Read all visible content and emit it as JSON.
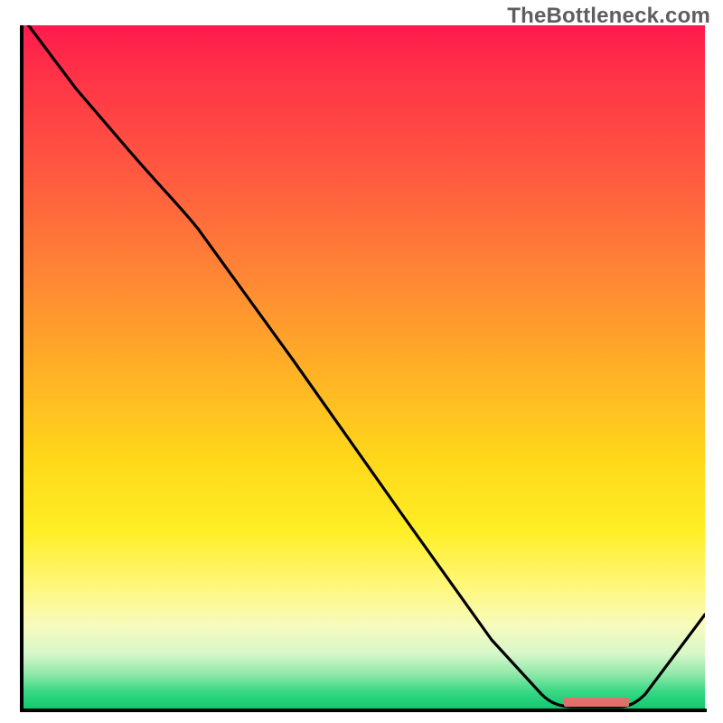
{
  "watermark": "TheBottleneck.com",
  "colors": {
    "axis": "#000000",
    "curve": "#000000",
    "marker": "#e0716a",
    "gradient_top": "#ff1a4d",
    "gradient_bottom": "#10c96f"
  },
  "chart_data": {
    "type": "line",
    "title": "",
    "xlabel": "",
    "ylabel": "",
    "xlim": [
      0,
      100
    ],
    "ylim": [
      0,
      100
    ],
    "grid": false,
    "legend": false,
    "background": "vertical-gradient red→green (low y = green/good, high y = red/bad)",
    "series": [
      {
        "name": "bottleneck-curve",
        "x": [
          0,
          8,
          16,
          26,
          40,
          56,
          69,
          76,
          81,
          87,
          91,
          100
        ],
        "y": [
          101,
          91,
          82,
          70,
          51,
          29,
          10,
          2,
          0.3,
          0.3,
          2,
          14
        ],
        "note": "y is % distance from bottom (0 = bottom/green). Curve reaches a flat minimum around x≈80–88 then rises."
      }
    ],
    "annotations": [
      {
        "name": "optimal-range-marker",
        "x_start": 79,
        "x_end": 89,
        "y": 0.3,
        "color": "#e0716a",
        "shape": "short horizontal bar at curve minimum"
      }
    ]
  }
}
